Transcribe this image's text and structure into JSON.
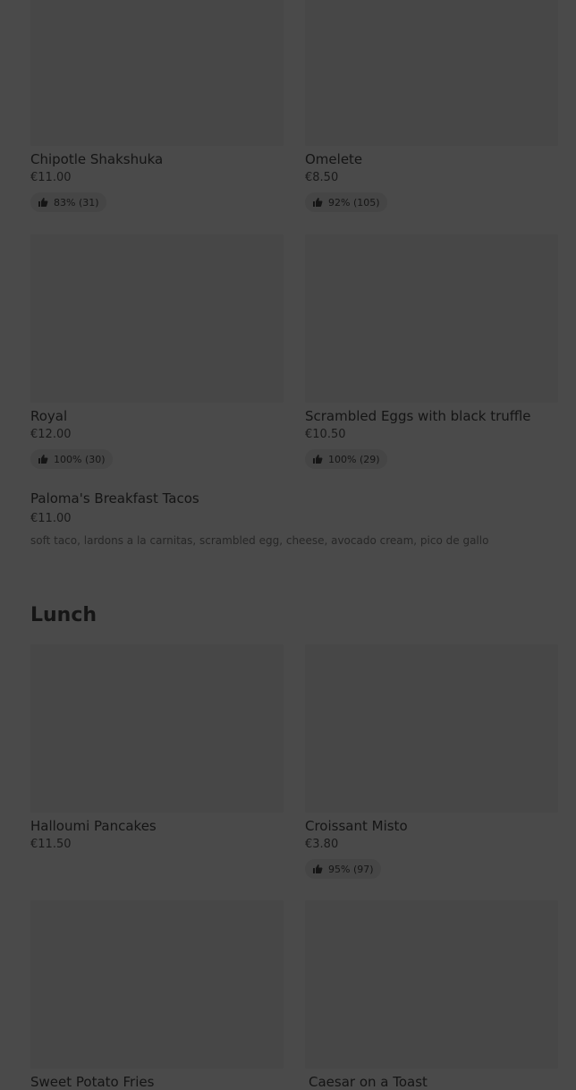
{
  "breakfast_items_top": [
    {
      "name": "Chipotle Shakshuka",
      "price": "€11.00",
      "rating": "83% (31)"
    },
    {
      "name": "Omelete",
      "price": "€8.50",
      "rating": "92% (105)"
    }
  ],
  "breakfast_items_mid": [
    {
      "name": "Royal",
      "price": "€12.00",
      "rating": "100% (30)"
    },
    {
      "name": "Scrambled Eggs with black truffle",
      "price": "€10.50",
      "rating": "100% (29)"
    }
  ],
  "featured_item": {
    "name": "Paloma's Breakfast Tacos",
    "price": "€11.00",
    "description": "soft taco, lardons a la carnitas, scrambled egg, cheese, avocado cream, pico de gallo"
  },
  "lunch": {
    "title": "Lunch",
    "items_top": [
      {
        "name": "Halloumi Pancakes",
        "price": "€11.50"
      },
      {
        "name": "Croissant Misto",
        "price": "€3.80",
        "rating": "95% (97)"
      }
    ],
    "items_bottom": [
      {
        "name": "Sweet Potato Fries"
      },
      {
        "name": "Caesar on a Toast"
      }
    ]
  },
  "icons": {
    "rating": "thumbs-up-icon"
  }
}
